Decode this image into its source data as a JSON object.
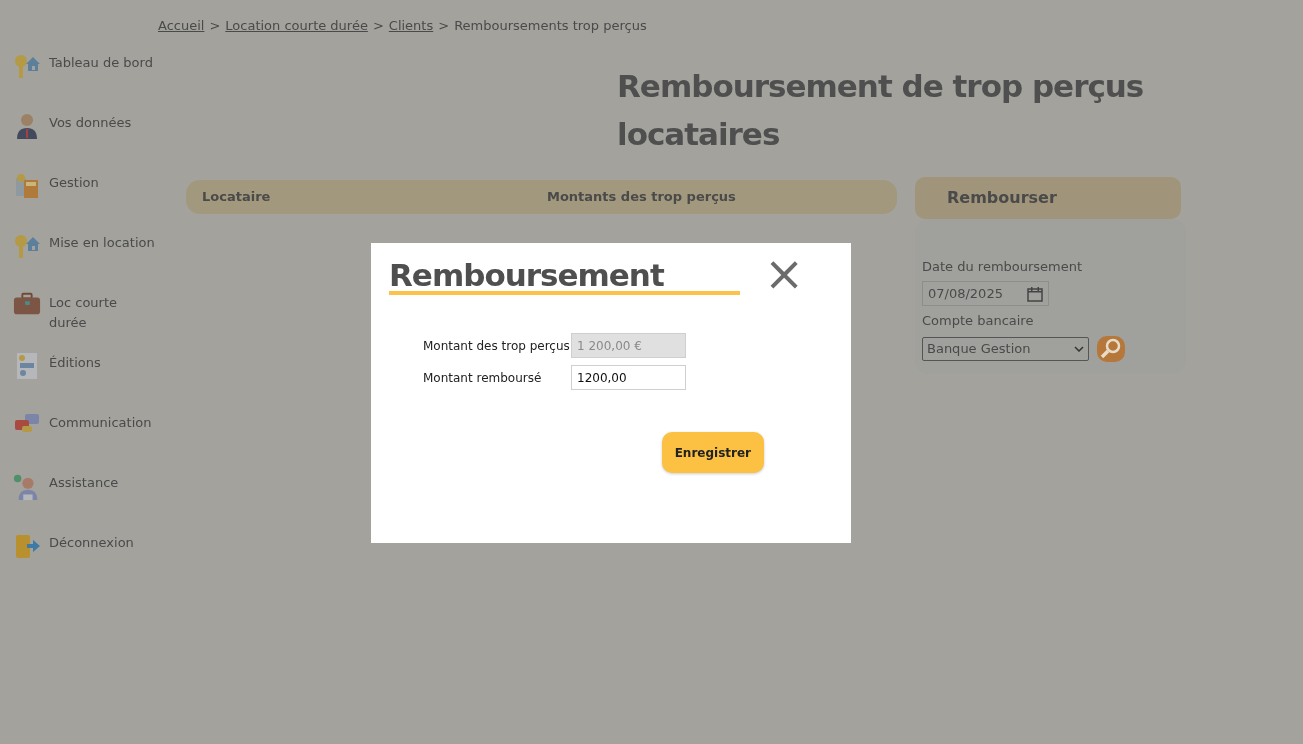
{
  "sidebar": {
    "items": [
      {
        "label": "Tableau de bord"
      },
      {
        "label": "Vos données"
      },
      {
        "label": "Gestion"
      },
      {
        "label": "Mise en location"
      },
      {
        "label": "Loc courte durée"
      },
      {
        "label": "Éditions"
      },
      {
        "label": "Communication"
      },
      {
        "label": "Assistance"
      },
      {
        "label": "Déconnexion"
      }
    ]
  },
  "breadcrumb": {
    "separator": ">",
    "links": [
      "Accueil",
      "Location courte durée",
      "Clients"
    ],
    "current": "Remboursements trop perçus"
  },
  "page_title": "Remboursement de trop perçus locataires",
  "table": {
    "columns": [
      "Locataire",
      "Montants des trop perçus"
    ]
  },
  "refund_panel": {
    "title": "Rembourser",
    "date_label": "Date du remboursement",
    "date_value": "07/08/2025",
    "account_label": "Compte bancaire",
    "account_value": "Banque Gestion"
  },
  "modal": {
    "title": "Remboursement",
    "close": "×",
    "fields": [
      {
        "label": "Montant des trop perçus",
        "value": "1 200,00 €",
        "disabled": true
      },
      {
        "label": "Montant remboursé",
        "value": "1200,00",
        "disabled": false
      }
    ],
    "save_button": "Enregistrer"
  }
}
